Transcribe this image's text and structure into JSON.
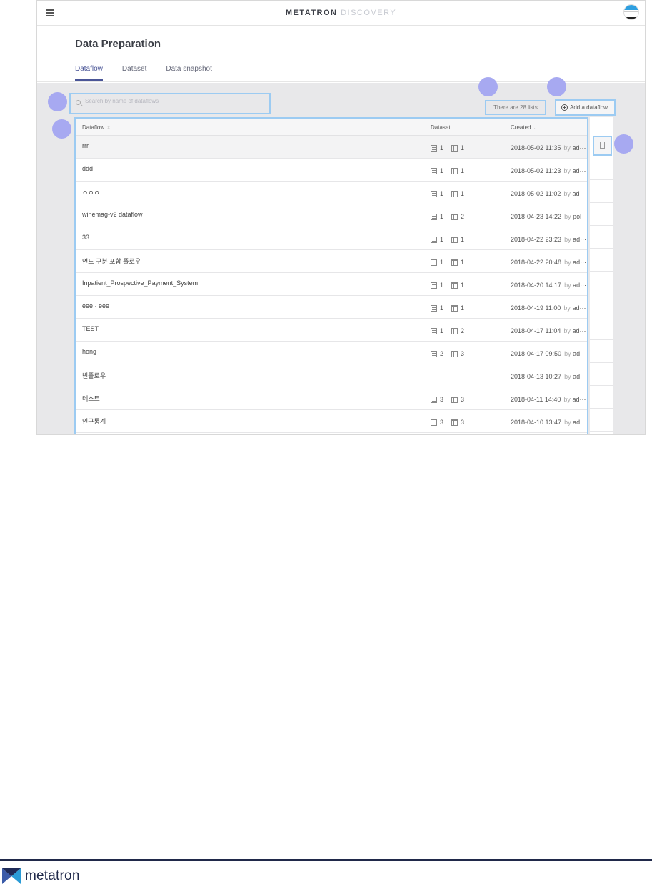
{
  "app": {
    "brand_primary": "METATRON",
    "brand_secondary": "DISCOVERY",
    "accent_color": "#4a5597",
    "highlight_color": "#9ccbf2",
    "callout_color": "#a7a9f1"
  },
  "header": {
    "menu_icon": "hamburger-menu-icon",
    "page_title": "Data Preparation",
    "tabs": [
      {
        "label": "Dataflow",
        "active": true
      },
      {
        "label": "Dataset",
        "active": false
      },
      {
        "label": "Data snapshot",
        "active": false
      }
    ]
  },
  "toolbar": {
    "search_placeholder": "Search by name of dataflows",
    "count_text": "There are 28 lists",
    "add_label": "Add a dataflow"
  },
  "table": {
    "columns": [
      "Dataflow",
      "Dataset",
      "Created"
    ],
    "sort_glyph": "⇕",
    "sort_desc_glyph": "⌄",
    "by_label": "by",
    "rows": [
      {
        "name": "rrr",
        "ds": "1",
        "tb": "1",
        "created": "2018-05-02 11:35",
        "user": "ad···"
      },
      {
        "name": "ddd",
        "ds": "1",
        "tb": "1",
        "created": "2018-05-02 11:23",
        "user": "ad···"
      },
      {
        "name": "ㅇㅇㅇ",
        "ds": "1",
        "tb": "1",
        "created": "2018-05-02 11:02",
        "user": "ad"
      },
      {
        "name": "winemag-v2 dataflow",
        "ds": "1",
        "tb": "2",
        "created": "2018-04-23 14:22",
        "user": "pol···"
      },
      {
        "name": "33",
        "ds": "1",
        "tb": "1",
        "created": "2018-04-22 23:23",
        "user": "ad···"
      },
      {
        "name": "연도 구분 포함 플로우",
        "ds": "1",
        "tb": "1",
        "created": "2018-04-22 20:48",
        "user": "ad···"
      },
      {
        "name": "Inpatient_Prospective_Payment_System",
        "ds": "1",
        "tb": "1",
        "created": "2018-04-20 14:17",
        "user": "ad···"
      },
      {
        "name": "eee · eee",
        "ds": "1",
        "tb": "1",
        "created": "2018-04-19 11:00",
        "user": "ad···"
      },
      {
        "name": "TEST",
        "ds": "1",
        "tb": "2",
        "created": "2018-04-17 11:04",
        "user": "ad···"
      },
      {
        "name": "hong",
        "ds": "2",
        "tb": "3",
        "created": "2018-04-17 09:50",
        "user": "ad···"
      },
      {
        "name": "빈플로우",
        "ds": "",
        "tb": "",
        "created": "2018-04-13 10:27",
        "user": "ad···"
      },
      {
        "name": "테스트",
        "ds": "3",
        "tb": "3",
        "created": "2018-04-11 14:40",
        "user": "ad···"
      },
      {
        "name": "인구통계",
        "ds": "3",
        "tb": "3",
        "created": "2018-04-10 13:47",
        "user": "ad"
      }
    ]
  },
  "footer": {
    "brand": "metatron"
  }
}
